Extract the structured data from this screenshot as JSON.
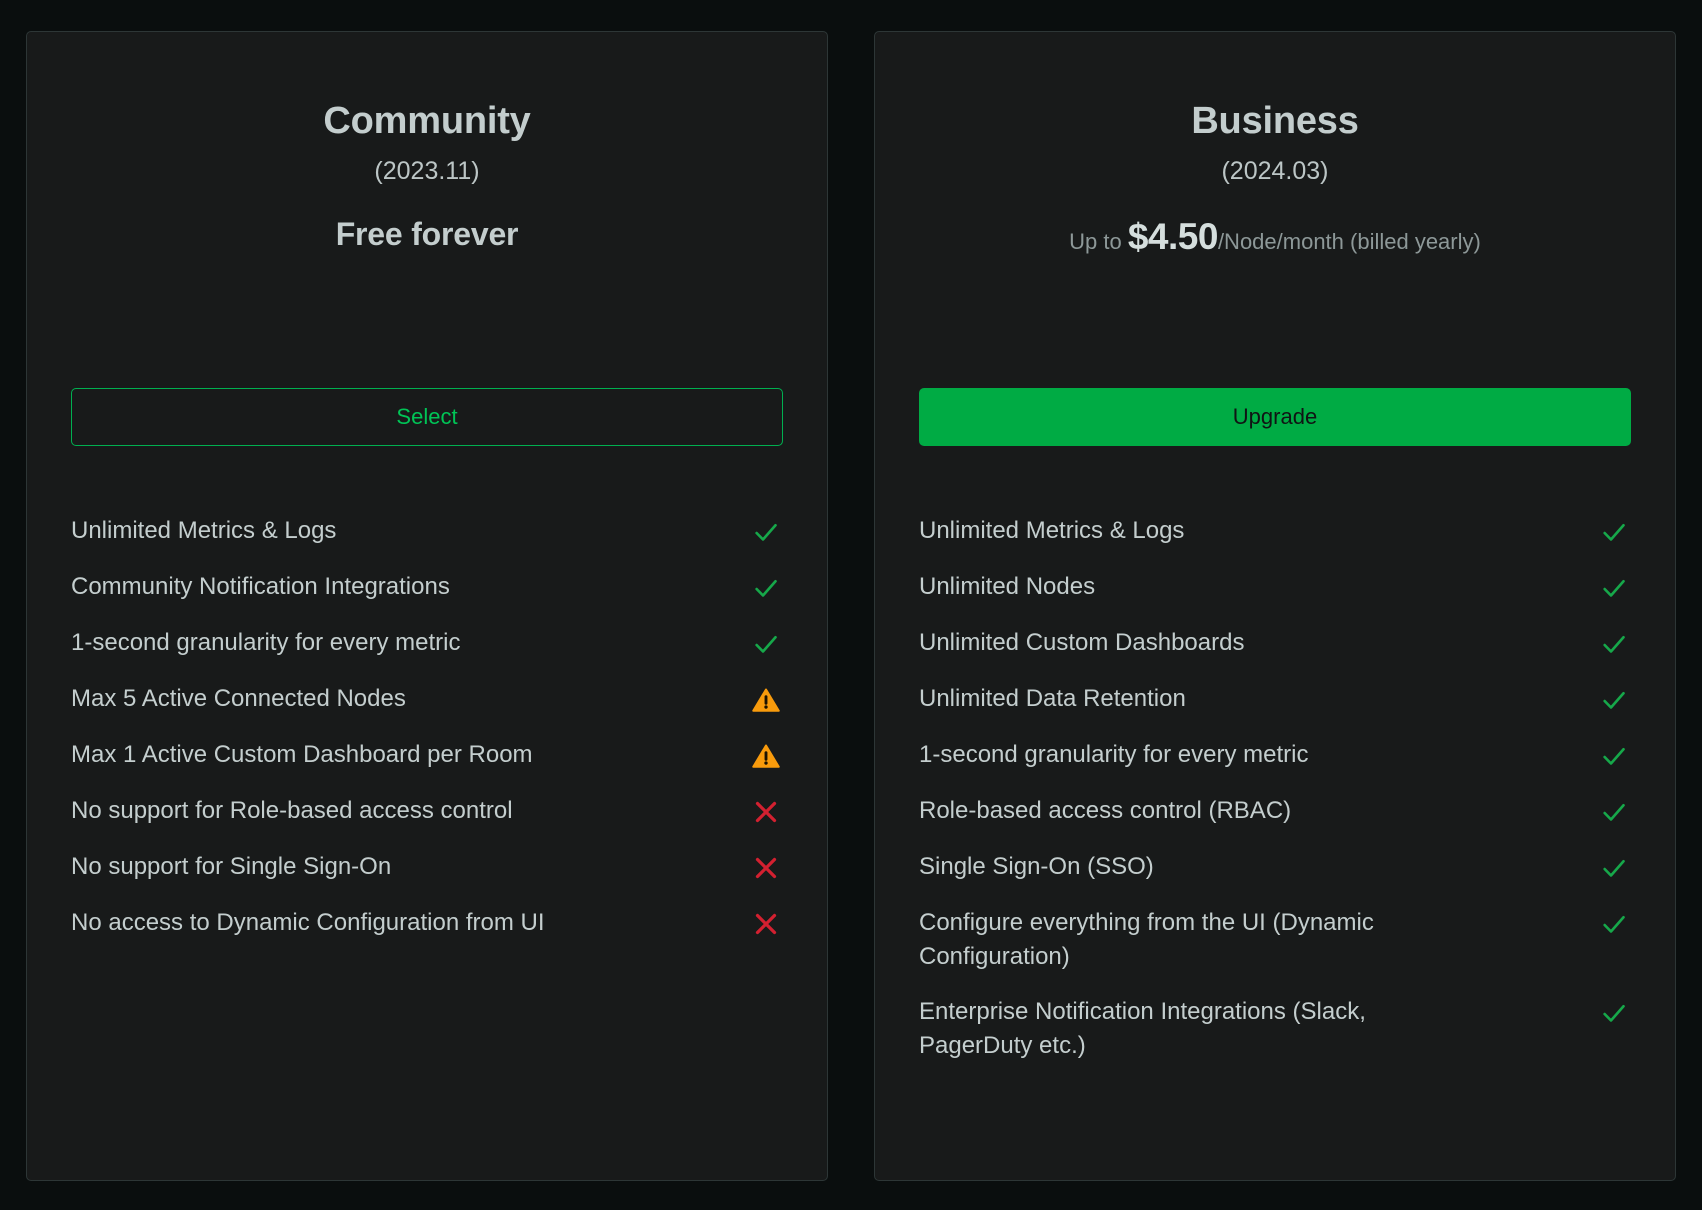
{
  "colors": {
    "page_background": "#0a0e0e",
    "card_background": "#181a1a",
    "card_border": "#2d3636",
    "text": "#c4cece",
    "accent_green": "#00ab44",
    "check_green": "#16a84a",
    "warning_orange": "#f89b0c",
    "error_red": "#d32030"
  },
  "plans": [
    {
      "name": "Community",
      "version": "(2023.11)",
      "price": {
        "style": "free",
        "free_label": "Free forever"
      },
      "button": {
        "label": "Select",
        "style": "outline"
      },
      "features": [
        {
          "label": "Unlimited Metrics & Logs",
          "icon": "check-icon"
        },
        {
          "label": "Community Notification Integrations",
          "icon": "check-icon"
        },
        {
          "label": "1-second granularity for every metric",
          "icon": "check-icon"
        },
        {
          "label": "Max 5 Active Connected Nodes",
          "icon": "warning-icon"
        },
        {
          "label": "Max 1 Active Custom Dashboard per Room",
          "icon": "warning-icon"
        },
        {
          "label": "No support for Role-based access control",
          "icon": "cross-icon"
        },
        {
          "label": "No support for Single Sign-On",
          "icon": "cross-icon"
        },
        {
          "label": "No access to Dynamic Configuration from UI",
          "icon": "cross-icon"
        }
      ]
    },
    {
      "name": "Business",
      "version": "(2024.03)",
      "price": {
        "style": "paid",
        "prefix": "Up to ",
        "amount": "$4.50",
        "suffix": "/Node/month (billed yearly)"
      },
      "button": {
        "label": "Upgrade",
        "style": "solid"
      },
      "features": [
        {
          "label": "Unlimited Metrics & Logs",
          "icon": "check-icon"
        },
        {
          "label": "Unlimited Nodes",
          "icon": "check-icon"
        },
        {
          "label": "Unlimited Custom Dashboards",
          "icon": "check-icon"
        },
        {
          "label": "Unlimited Data Retention",
          "icon": "check-icon"
        },
        {
          "label": "1-second granularity for every metric",
          "icon": "check-icon"
        },
        {
          "label": "Role-based access control (RBAC)",
          "icon": "check-icon"
        },
        {
          "label": "Single Sign-On (SSO)",
          "icon": "check-icon"
        },
        {
          "label": "Configure everything from the UI (Dynamic Configuration)",
          "icon": "check-icon"
        },
        {
          "label": "Enterprise Notification Integrations (Slack, PagerDuty etc.)",
          "icon": "check-icon"
        }
      ]
    }
  ]
}
